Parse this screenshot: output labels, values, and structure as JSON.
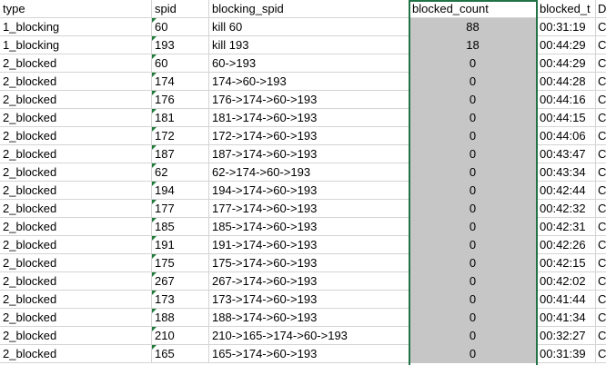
{
  "headers": {
    "type": "type",
    "spid": "spid",
    "blocking_spid": "blocking_spid",
    "blocked_count": "blocked_count",
    "blocked_time": "blocked_t",
    "next": "D"
  },
  "rows": [
    {
      "type": "1_blocking",
      "spid": "60",
      "blocking_spid": "kill 60",
      "blocked_count": "88",
      "blocked_time": "00:31:19",
      "next": "C"
    },
    {
      "type": "1_blocking",
      "spid": "193",
      "blocking_spid": "kill 193",
      "blocked_count": "18",
      "blocked_time": "00:44:29",
      "next": "C"
    },
    {
      "type": "2_blocked",
      "spid": "60",
      "blocking_spid": "60->193",
      "blocked_count": "0",
      "blocked_time": "00:44:29",
      "next": "C"
    },
    {
      "type": "2_blocked",
      "spid": "174",
      "blocking_spid": "174->60->193",
      "blocked_count": "0",
      "blocked_time": "00:44:28",
      "next": "C"
    },
    {
      "type": "2_blocked",
      "spid": "176",
      "blocking_spid": "176->174->60->193",
      "blocked_count": "0",
      "blocked_time": "00:44:16",
      "next": "C"
    },
    {
      "type": "2_blocked",
      "spid": "181",
      "blocking_spid": "181->174->60->193",
      "blocked_count": "0",
      "blocked_time": "00:44:15",
      "next": "C"
    },
    {
      "type": "2_blocked",
      "spid": "172",
      "blocking_spid": "172->174->60->193",
      "blocked_count": "0",
      "blocked_time": "00:44:06",
      "next": "C"
    },
    {
      "type": "2_blocked",
      "spid": "187",
      "blocking_spid": "187->174->60->193",
      "blocked_count": "0",
      "blocked_time": "00:43:47",
      "next": "C"
    },
    {
      "type": "2_blocked",
      "spid": "62",
      "blocking_spid": "62->174->60->193",
      "blocked_count": "0",
      "blocked_time": "00:43:34",
      "next": "C"
    },
    {
      "type": "2_blocked",
      "spid": "194",
      "blocking_spid": "194->174->60->193",
      "blocked_count": "0",
      "blocked_time": "00:42:44",
      "next": "C"
    },
    {
      "type": "2_blocked",
      "spid": "177",
      "blocking_spid": "177->174->60->193",
      "blocked_count": "0",
      "blocked_time": "00:42:32",
      "next": "C"
    },
    {
      "type": "2_blocked",
      "spid": "185",
      "blocking_spid": "185->174->60->193",
      "blocked_count": "0",
      "blocked_time": "00:42:31",
      "next": "C"
    },
    {
      "type": "2_blocked",
      "spid": "191",
      "blocking_spid": "191->174->60->193",
      "blocked_count": "0",
      "blocked_time": "00:42:26",
      "next": "C"
    },
    {
      "type": "2_blocked",
      "spid": "175",
      "blocking_spid": "175->174->60->193",
      "blocked_count": "0",
      "blocked_time": "00:42:15",
      "next": "C"
    },
    {
      "type": "2_blocked",
      "spid": "267",
      "blocking_spid": "267->174->60->193",
      "blocked_count": "0",
      "blocked_time": "00:42:02",
      "next": "C"
    },
    {
      "type": "2_blocked",
      "spid": "173",
      "blocking_spid": "173->174->60->193",
      "blocked_count": "0",
      "blocked_time": "00:41:44",
      "next": "C"
    },
    {
      "type": "2_blocked",
      "spid": "188",
      "blocking_spid": "188->174->60->193",
      "blocked_count": "0",
      "blocked_time": "00:41:34",
      "next": "C"
    },
    {
      "type": "2_blocked",
      "spid": "210",
      "blocking_spid": "210->165->174->60->193",
      "blocked_count": "0",
      "blocked_time": "00:32:27",
      "next": "C"
    },
    {
      "type": "2_blocked",
      "spid": "165",
      "blocking_spid": "165->174->60->193",
      "blocked_count": "0",
      "blocked_time": "00:31:39",
      "next": "C"
    }
  ],
  "colors": {
    "selection_border": "#217346",
    "selected_fill": "#c6c6c6",
    "gridline": "#d4d4d4",
    "error_indicator": "#1f7a3a"
  }
}
